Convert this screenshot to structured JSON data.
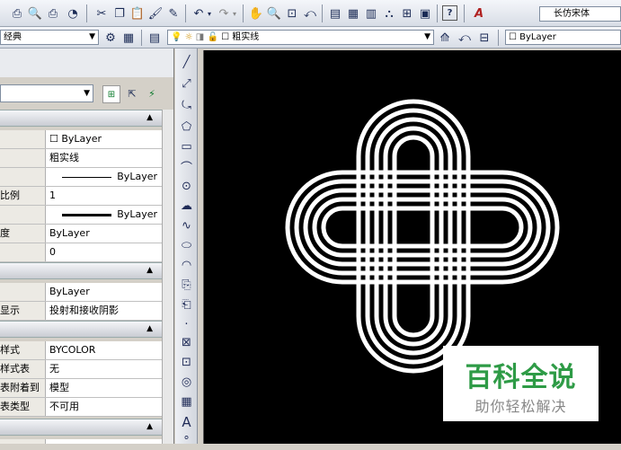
{
  "toolbar_top": {
    "font_combo": "长仿宋体"
  },
  "toolbar_second": {
    "workspace_combo": "经典",
    "layer_name": "粗实线",
    "color_combo": "ByLayer"
  },
  "properties": {
    "sections": [
      {
        "rows": [
          {
            "label": "",
            "value": "ByLayer",
            "swatch": true
          },
          {
            "label": "",
            "value": "粗实线"
          },
          {
            "label": "",
            "value": "ByLayer",
            "line": "thin"
          },
          {
            "label": "比例",
            "value": "1"
          },
          {
            "label": "",
            "value": "ByLayer",
            "line": "thick"
          },
          {
            "label": "度",
            "value": "ByLayer"
          },
          {
            "label": "",
            "value": "0"
          }
        ]
      },
      {
        "rows": [
          {
            "label": "",
            "value": "ByLayer"
          },
          {
            "label": "显示",
            "value": "投射和接收阴影"
          }
        ]
      },
      {
        "rows": [
          {
            "label": "样式",
            "value": "BYCOLOR"
          },
          {
            "label": "样式表",
            "value": "无"
          },
          {
            "label": "表附着到",
            "value": "模型"
          },
          {
            "label": "表类型",
            "value": "不可用"
          }
        ]
      }
    ]
  },
  "watermark": {
    "title": "百科全说",
    "subtitle": "助你轻松解决"
  },
  "colors": {
    "canvas_bg": "#000000",
    "drawing_stroke": "#ffffff",
    "watermark_green": "#2e9b46"
  }
}
